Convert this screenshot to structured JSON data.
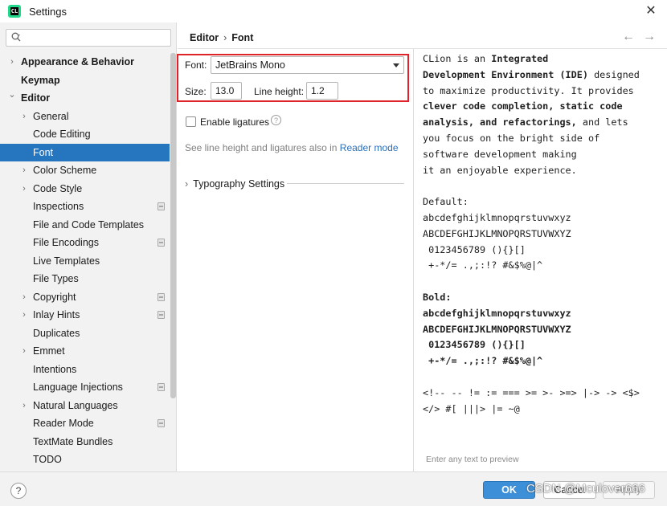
{
  "window": {
    "title": "Settings"
  },
  "search": {
    "placeholder": "Q+"
  },
  "sidebar": {
    "items": [
      {
        "label": "Appearance & Behavior",
        "arrow": ">",
        "bold": true
      },
      {
        "label": "Keymap",
        "arrow": "",
        "bold": true
      },
      {
        "label": "Editor",
        "arrow": "v",
        "bold": true
      },
      {
        "label": "General",
        "arrow": ">"
      },
      {
        "label": "Code Editing",
        "arrow": ""
      },
      {
        "label": "Font",
        "arrow": "",
        "selected": true
      },
      {
        "label": "Color Scheme",
        "arrow": ">"
      },
      {
        "label": "Code Style",
        "arrow": ">"
      },
      {
        "label": "Inspections",
        "arrow": "",
        "project_icon": true
      },
      {
        "label": "File and Code Templates",
        "arrow": ""
      },
      {
        "label": "File Encodings",
        "arrow": "",
        "project_icon": true
      },
      {
        "label": "Live Templates",
        "arrow": ""
      },
      {
        "label": "File Types",
        "arrow": ""
      },
      {
        "label": "Copyright",
        "arrow": ">",
        "project_icon": true
      },
      {
        "label": "Inlay Hints",
        "arrow": ">",
        "project_icon": true
      },
      {
        "label": "Duplicates",
        "arrow": ""
      },
      {
        "label": "Emmet",
        "arrow": ">"
      },
      {
        "label": "Intentions",
        "arrow": ""
      },
      {
        "label": "Language Injections",
        "arrow": "",
        "project_icon": true
      },
      {
        "label": "Natural Languages",
        "arrow": ">"
      },
      {
        "label": "Reader Mode",
        "arrow": "",
        "project_icon": true
      },
      {
        "label": "TextMate Bundles",
        "arrow": ""
      },
      {
        "label": "TODO",
        "arrow": ""
      }
    ]
  },
  "breadcrumb": {
    "parent": "Editor",
    "separator": "›",
    "current": "Font"
  },
  "nav": {
    "back": "←",
    "forward": "→"
  },
  "font_settings": {
    "font_label": "Font:",
    "font_value": "JetBrains Mono",
    "size_label": "Size:",
    "size_value": "13.0",
    "line_height_label": "Line height:",
    "line_height_value": "1.2",
    "ligatures_label": "Enable ligatures",
    "ligatures_checked": false,
    "help_glyph": "?",
    "hint_text": "See line height and ligatures also in ",
    "hint_link": "Reader mode",
    "typography_label": "Typography Settings"
  },
  "preview": {
    "intro_lines": [
      [
        [
          "CLion is an ",
          false
        ],
        [
          "Integrated",
          true
        ]
      ],
      [
        [
          "Development Environment (IDE)",
          true
        ],
        [
          " designed",
          false
        ]
      ],
      [
        [
          "to maximize productivity. It provides",
          false
        ]
      ],
      [
        [
          "clever code completion, static code",
          true
        ]
      ],
      [
        [
          "analysis, and refactorings,",
          true
        ],
        [
          " and lets",
          false
        ]
      ],
      [
        [
          "you focus on the bright side of",
          false
        ]
      ],
      [
        [
          "software development making",
          false
        ]
      ],
      [
        [
          "it an enjoyable experience.",
          false
        ]
      ]
    ],
    "default_label": "Default:",
    "default_lines": [
      "abcdefghijklmnopqrstuvwxyz",
      "ABCDEFGHIJKLMNOPQRSTUVWXYZ",
      " 0123456789 (){}[]",
      " +-*/= .,;:!? #&$%@|^"
    ],
    "bold_label": "Bold:",
    "bold_lines": [
      "abcdefghijklmnopqrstuvwxyz",
      "ABCDEFGHIJKLMNOPQRSTUVWXYZ",
      " 0123456789 (){}[]",
      " +-*/= .,;:!? #&$%@|^"
    ],
    "ligature_lines": [
      "<!-- -- != := === >= >- >=> |-> -> <$>",
      "</> #[ |||> |= ~@"
    ],
    "placeholder": "Enter any text to preview"
  },
  "footer": {
    "help_glyph": "?",
    "ok": "OK",
    "cancel": "Cancel",
    "apply": "Apply",
    "watermark": "CSDN @Mculover666"
  }
}
